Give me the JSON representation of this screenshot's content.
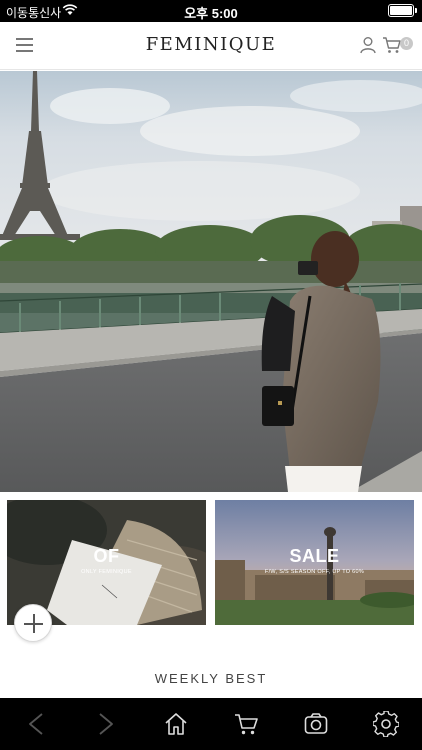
{
  "status_bar": {
    "carrier": "이동통신사",
    "time": "오후 5:00"
  },
  "header": {
    "logo": "FEMINIQUE",
    "cart_count": "0",
    "icons": [
      "menu-icon",
      "user-icon",
      "cart-icon"
    ]
  },
  "hero": {
    "slide_count": 6,
    "active_slide": 4
  },
  "banners": [
    {
      "title": "OF",
      "subtitle": "ONLY FEMINIQUE"
    },
    {
      "title": "SALE",
      "subtitle": "F/W, S/S SEASON OFF, UP TO 60%"
    }
  ],
  "section_title": "WEEKLY BEST",
  "toolbar": {
    "icons": [
      "back-arrow-icon",
      "forward-arrow-icon",
      "home-icon",
      "cart-icon",
      "camera-icon",
      "settings-icon"
    ]
  },
  "colors": {
    "status_bar_bg": "#000000",
    "toolbar_bg": "#000000",
    "badge": "#c8c8c8"
  }
}
